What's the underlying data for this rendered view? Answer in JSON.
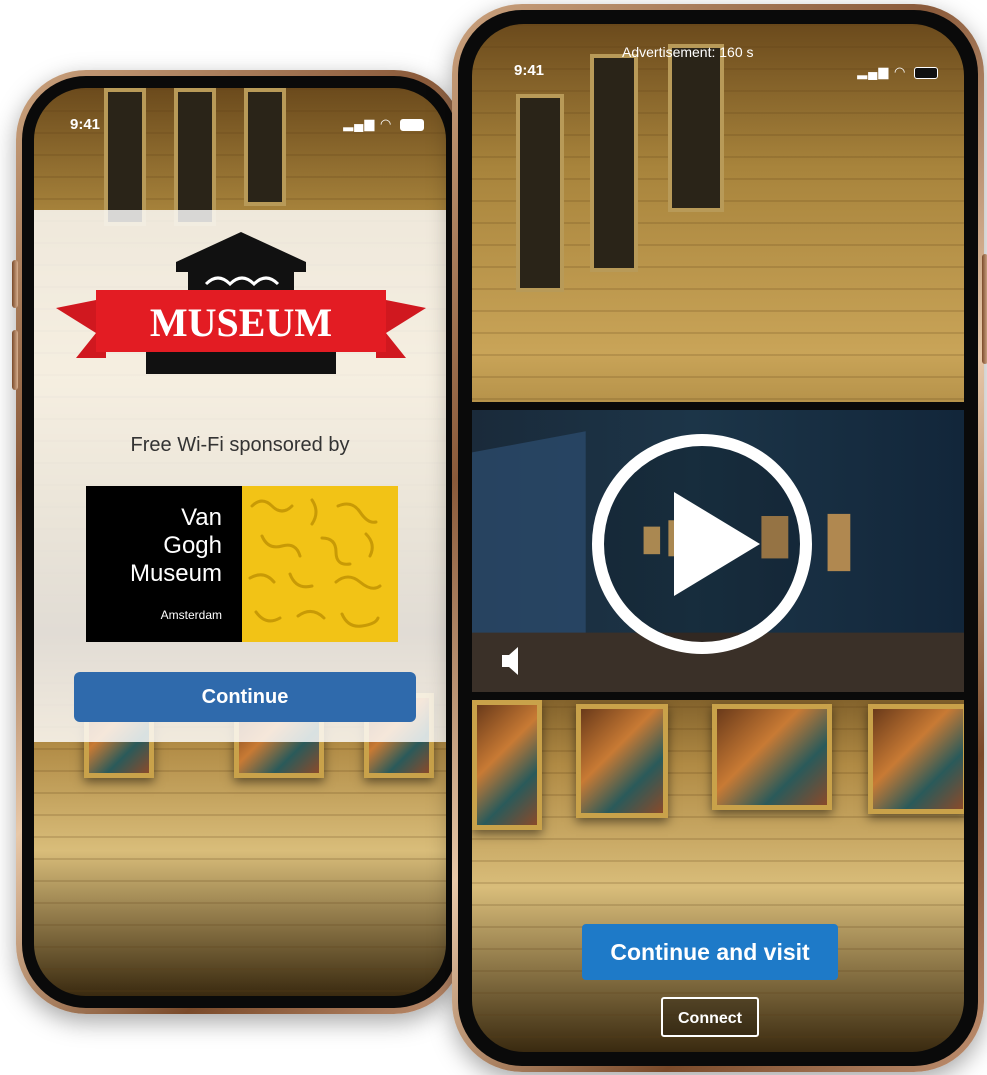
{
  "left_phone": {
    "status_time": "9:41",
    "logo_text": "MUSEUM",
    "sponsor_text": "Free Wi-Fi sponsored by",
    "sponsor_logo": {
      "line1": "Van",
      "line2": "Gogh",
      "line3": "Museum",
      "city": "Amsterdam"
    },
    "continue_label": "Continue"
  },
  "right_phone": {
    "status_time": "9:41",
    "ad_banner": "Advertisement: 160 s",
    "continue_visit_label": "Continue and visit",
    "connect_label": "Connect",
    "icons": [
      "play-icon",
      "volume-icon"
    ]
  },
  "colors": {
    "primary_button": "#2f6aac",
    "visit_button": "#1e7ac8",
    "museum_red": "#e31c23",
    "vg_yellow": "#f2c316"
  }
}
